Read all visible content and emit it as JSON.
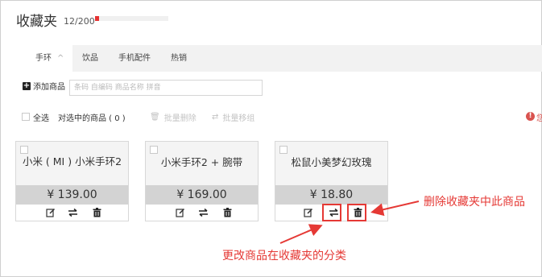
{
  "header": {
    "title": "收藏夹",
    "count": "12/200",
    "usage_fraction": 0.06
  },
  "tabs": [
    {
      "label": "手环",
      "active": true,
      "chevron": "^"
    },
    {
      "label": "饮品",
      "active": false
    },
    {
      "label": "手机配件",
      "active": false
    },
    {
      "label": "热销",
      "active": false
    }
  ],
  "add": {
    "label": "添加商品",
    "icon": "plus-square-icon",
    "placeholder": "条码 自编码 商品名称 拼音"
  },
  "bulk": {
    "select_all": "全选",
    "selected": "对选中的商品 ( 0 )",
    "delete_label": "批量删除",
    "move_label": "批量移组",
    "delete_icon": "trash-icon",
    "move_icon": "swap-icon"
  },
  "notice": {
    "icon": "info-icon",
    "text": "您"
  },
  "products": [
    {
      "name": "小米 ( MI ) 小米手环2",
      "price": "¥ 139.00"
    },
    {
      "name": "小米手环2 + 腕带",
      "price": "¥ 169.00"
    },
    {
      "name": "松鼠小美梦幻玫瑰",
      "price": "¥ 18.80"
    }
  ],
  "card_action_icons": [
    "edit-icon",
    "swap-icon",
    "trash-icon"
  ],
  "annotations": {
    "delete": "删除收藏夹中此商品",
    "move": "更改商品在收藏夹的分类"
  },
  "colors": {
    "accent": "#e53333",
    "annotation": "#e53935",
    "price_bar": "#d3d3d3"
  }
}
